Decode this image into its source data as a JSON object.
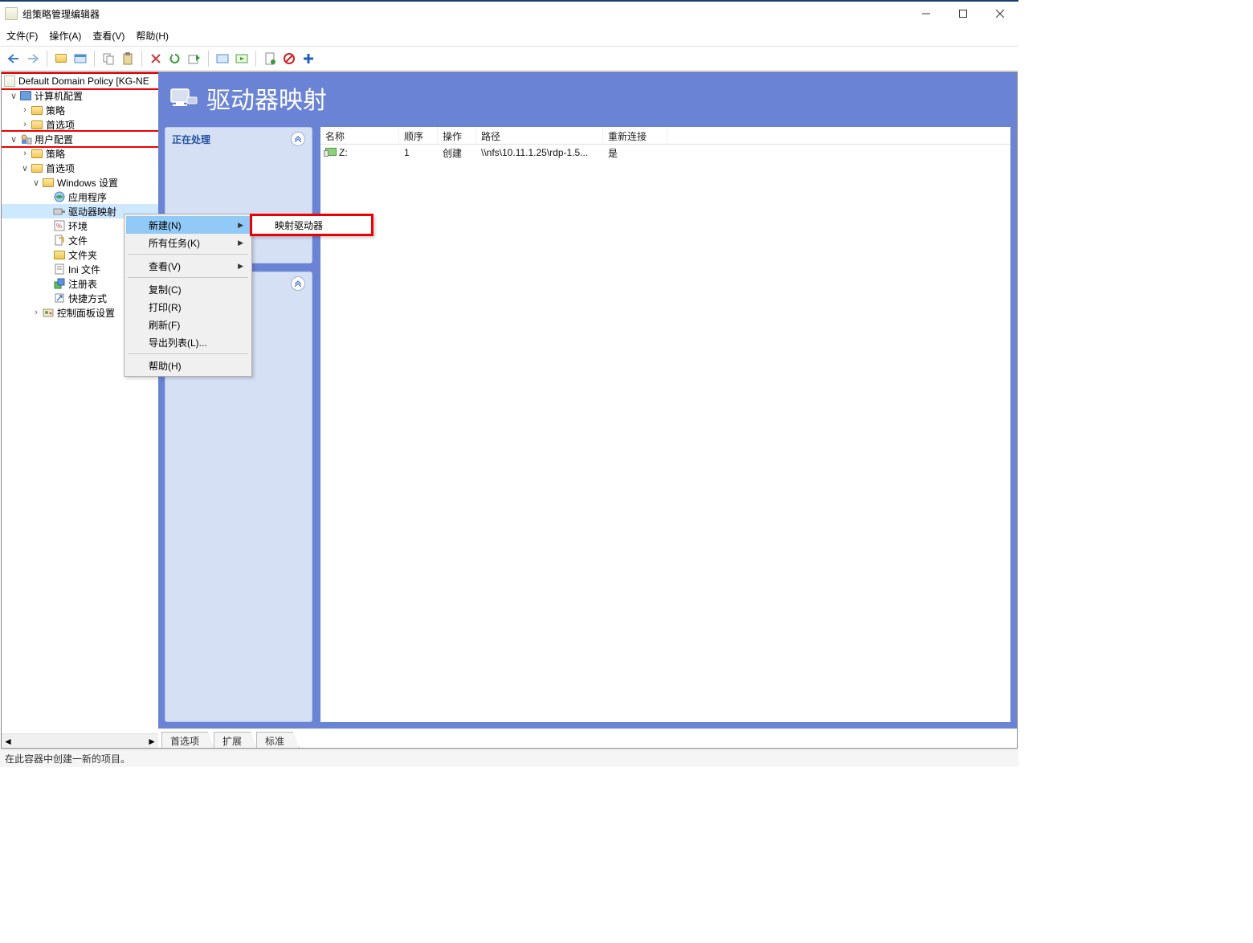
{
  "window": {
    "title": "组策略管理编辑器"
  },
  "menu": {
    "file": "文件(F)",
    "action": "操作(A)",
    "view": "查看(V)",
    "help": "帮助(H)"
  },
  "tree": {
    "root": "Default Domain Policy [KG-NE",
    "computer_config": "计算机配置",
    "policies1": "策略",
    "prefs1": "首选项",
    "user_config": "用户配置",
    "policies2": "策略",
    "prefs2": "首选项",
    "win_settings": "Windows 设置",
    "apps": "应用程序",
    "drive_maps": "驱动器映射",
    "env": "环境",
    "files": "文件",
    "folders": "文件夹",
    "ini": "Ini 文件",
    "registry": "注册表",
    "shortcuts": "快捷方式",
    "cp_settings": "控制面板设置"
  },
  "content": {
    "title": "驱动器映射",
    "processing": "正在处理",
    "columns": {
      "name": "名称",
      "order": "顺序",
      "action": "操作",
      "path": "路径",
      "reconnect": "重新连接"
    },
    "row": {
      "name": "Z:",
      "order": "1",
      "action": "创建",
      "path": "\\\\nfs\\10.11.1.25\\rdp-1.5...",
      "reconnect": "是"
    }
  },
  "tabs": {
    "prefs": "首选项",
    "ext": "扩展",
    "std": "标准"
  },
  "context": {
    "new": "新建(N)",
    "all_tasks": "所有任务(K)",
    "view": "查看(V)",
    "copy": "复制(C)",
    "print": "打印(R)",
    "refresh": "刷新(F)",
    "export": "导出列表(L)...",
    "help": "帮助(H)",
    "map_drive": "映射驱动器"
  },
  "status": "在此容器中创建一新的项目。"
}
